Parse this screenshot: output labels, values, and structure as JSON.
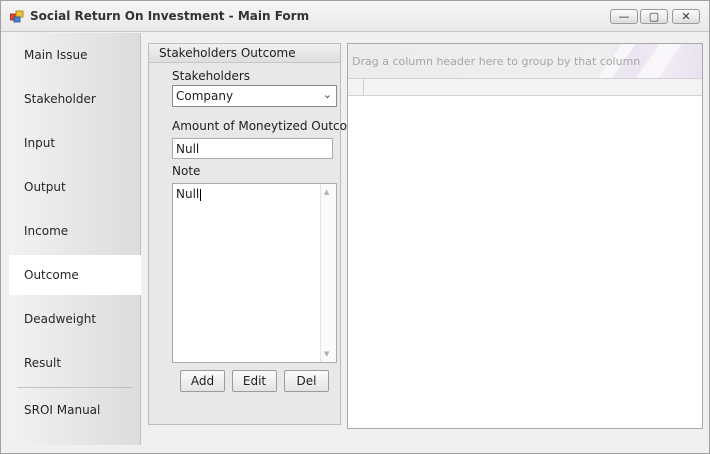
{
  "window": {
    "title": "Social Return On Investment - Main Form",
    "controls": {
      "minimize": "—",
      "maximize": "▢",
      "close": "✕"
    }
  },
  "nav": {
    "active": "Outcome",
    "items": [
      {
        "label": "Main Issue"
      },
      {
        "label": "Stakeholder"
      },
      {
        "label": "Input"
      },
      {
        "label": "Output"
      },
      {
        "label": "Income"
      },
      {
        "label": "Outcome"
      },
      {
        "label": "Deadweight"
      },
      {
        "label": "Result"
      },
      {
        "label": "SROI Manual"
      }
    ]
  },
  "form": {
    "header": "Stakeholders Outcome",
    "stakeholders_label": "Stakeholders",
    "stakeholders_value": "Company",
    "amount_label": "Amount of Moneytized Outcome",
    "amount_value": "Null",
    "note_label": "Note",
    "note_value": "Null",
    "buttons": {
      "add": "Add",
      "edit": "Edit",
      "del": "Del"
    }
  },
  "grid": {
    "group_panel_text": "Drag a column header here to group by that column"
  },
  "icons": {
    "app": "app-icon",
    "combo_arrow": "chevron-down-icon",
    "scroll_up": "scroll-up-icon",
    "scroll_down": "scroll-down-icon"
  },
  "colors": {
    "active_nav_bg": "#ffffff",
    "nav_gradient_end": "#dcdcdc",
    "group_panel_accent": "#ebe4f1"
  }
}
